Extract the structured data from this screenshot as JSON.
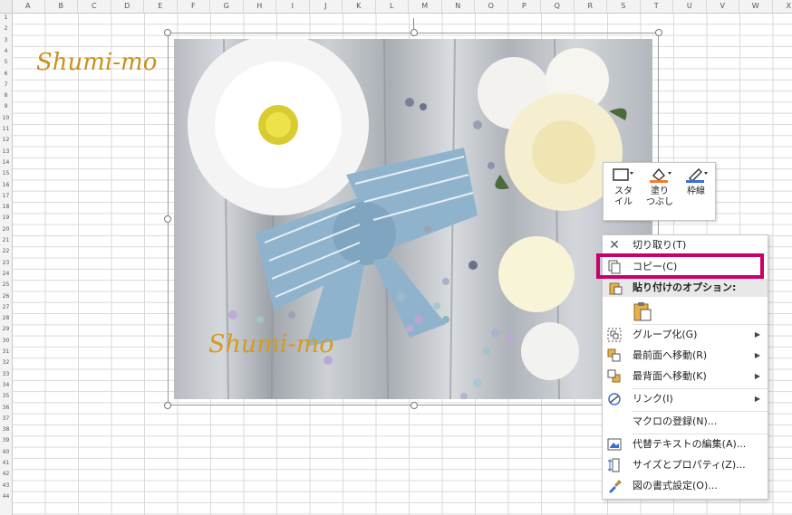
{
  "columns": [
    "A",
    "B",
    "C",
    "D",
    "E",
    "F",
    "G",
    "H",
    "I",
    "J",
    "K",
    "L",
    "M",
    "N",
    "O",
    "P",
    "Q",
    "R",
    "S",
    "T",
    "U",
    "V",
    "W",
    "X"
  ],
  "rows": [
    "1",
    "2",
    "3",
    "4",
    "5",
    "6",
    "7",
    "8",
    "9",
    "10",
    "11",
    "12",
    "13",
    "14",
    "15",
    "16",
    "17",
    "18",
    "19",
    "20",
    "21",
    "22",
    "23",
    "24",
    "25",
    "26",
    "27",
    "28",
    "29",
    "30",
    "31",
    "32",
    "33",
    "34",
    "35",
    "36",
    "37",
    "38",
    "39",
    "40",
    "41",
    "42",
    "43",
    "44"
  ],
  "brand_text": "Shumi-mo",
  "photo_watermark": "Shumi-mo",
  "mini_toolbar": {
    "style_label": "スタイル",
    "fill_label": "塗りつぶし",
    "outline_label": "枠線"
  },
  "context_menu": {
    "cut": "切り取り(T)",
    "copy": "コピー(C)",
    "paste_options_header": "貼り付けのオプション:",
    "group": "グループ化(G)",
    "bring_to_front": "最前面へ移動(R)",
    "send_to_back": "最背面へ移動(K)",
    "link": "リンク(I)",
    "assign_macro": "マクロの登録(N)...",
    "edit_alt_text": "代替テキストの編集(A)...",
    "size_properties": "サイズとプロパティ(Z)...",
    "format_picture": "図の書式設定(O)..."
  },
  "colors": {
    "highlight": "#c8006e",
    "brand": "#c9911a",
    "fill_accent": "#f07d2a",
    "outline_accent": "#3a6fd0"
  }
}
